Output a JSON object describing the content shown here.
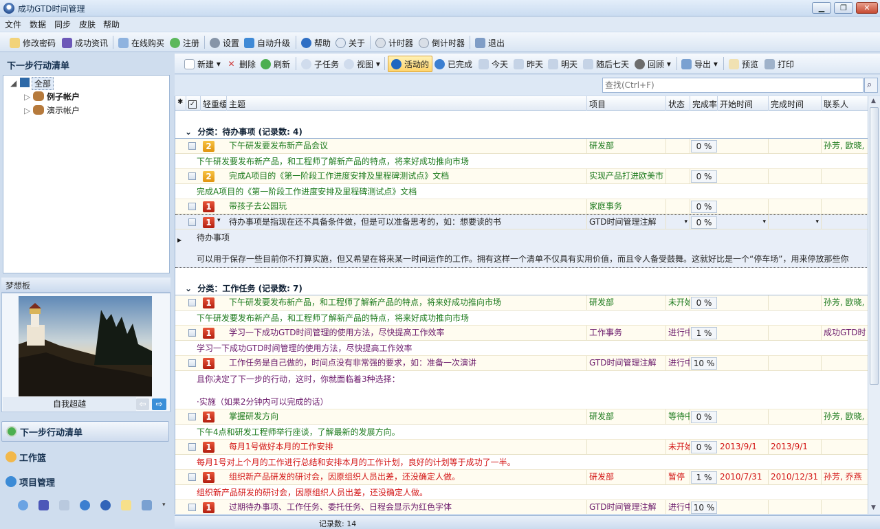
{
  "window": {
    "title": "成功GTD时间管理"
  },
  "menu": [
    "文件",
    "数据",
    "同步",
    "皮肤",
    "帮助"
  ],
  "toolbar1": [
    {
      "label": "修改密码",
      "icon": "key-icon"
    },
    {
      "label": "成功资讯",
      "icon": "book-icon"
    },
    {
      "label": "在线购买",
      "icon": "cart-icon"
    },
    {
      "label": "注册",
      "icon": "recycle-icon"
    },
    {
      "label": "设置",
      "icon": "gear-icon"
    },
    {
      "label": "自动升级",
      "icon": "up-arrow-icon"
    },
    {
      "label": "帮助",
      "icon": "help-icon"
    },
    {
      "label": "关于",
      "icon": "info-icon"
    },
    {
      "label": "计时器",
      "icon": "clock-icon"
    },
    {
      "label": "倒计时器",
      "icon": "countdown-icon"
    },
    {
      "label": "退出",
      "icon": "exit-icon"
    }
  ],
  "left": {
    "title": "下一步行动清单",
    "tree": {
      "root": "全部",
      "children": [
        "例子帐户",
        "演示帐户"
      ]
    },
    "dream": {
      "title": "梦想板",
      "caption": "自我超越"
    },
    "nav": [
      "下一步行动清单",
      "工作篮",
      "项目管理"
    ]
  },
  "toolbar2": [
    {
      "label": "新建",
      "icon": "new-doc-icon"
    },
    {
      "label": "删除",
      "icon": "delete-x-icon"
    },
    {
      "label": "刷新",
      "icon": "refresh-icon"
    },
    {
      "label": "子任务",
      "icon": "subtask-icon"
    },
    {
      "label": "视图",
      "icon": "view-icon"
    },
    {
      "label": "活动的",
      "icon": "info-icon"
    },
    {
      "label": "已完成",
      "icon": "check-icon"
    },
    {
      "label": "今天",
      "icon": "calendar-icon"
    },
    {
      "label": "昨天",
      "icon": "calendar-icon"
    },
    {
      "label": "明天",
      "icon": "calendar-icon"
    },
    {
      "label": "随后七天",
      "icon": "calendar-icon"
    },
    {
      "label": "回顾",
      "icon": "review-icon"
    },
    {
      "label": "导出",
      "icon": "export-icon"
    },
    {
      "label": "预览",
      "icon": "preview-icon"
    },
    {
      "label": "打印",
      "icon": "printer-icon"
    }
  ],
  "search": {
    "placeholder": "查找(Ctrl+F)"
  },
  "columns": [
    "轻重缓急",
    "主题",
    "项目",
    "状态",
    "完成率",
    "开始时间",
    "完成时间",
    "联系人"
  ],
  "groups": [
    {
      "title": "分类：待办事项 (记录数: 4)"
    },
    {
      "title": "分类：工作任务 (记录数: 7)"
    }
  ],
  "rows": [
    {
      "p": "2",
      "subject": "下午研发要发布新产品会议",
      "project": "研发部",
      "status": "",
      "pct": "0 %",
      "start": "",
      "end": "",
      "contact": "孙芳, 欧晓,",
      "note": "下午研发要发布新产品，和工程师了解新产品的特点，将来好成功推向市场"
    },
    {
      "p": "2",
      "subject": "完成A项目的《第一阶段工作进度安排及里程碑测试点》文档",
      "project": "实现产品打进欧美市",
      "status": "",
      "pct": "0 %",
      "start": "",
      "end": "",
      "contact": "",
      "note": "完成A项目的《第一阶段工作进度安排及里程碑测试点》文档"
    },
    {
      "p": "1",
      "subject": "带孩子去公园玩",
      "project": "家庭事务",
      "status": "",
      "pct": "0 %",
      "start": "",
      "end": "",
      "contact": "",
      "note": ""
    },
    {
      "p": "1",
      "subject": "待办事项是指现在还不具备条件做，但是可以准备思考的，如：想要读的书",
      "project": "GTD时间管理注解",
      "status": "",
      "pct": "0 %",
      "start": "",
      "end": "",
      "contact": "",
      "note": "待办事项",
      "note2": "可以用于保存一些目前你不打算实施，但又希望在将来某一时间运作的工作。拥有这样一个清单不仅具有实用价值，而且令人备受鼓舞。这就好比是一个“停车场”，用来停放那些你"
    },
    {
      "p": "1",
      "subject": "下午研发要发布新产品，和工程师了解新产品的特点，将来好成功推向市场",
      "project": "研发部",
      "status": "未开始",
      "pct": "0 %",
      "start": "",
      "end": "",
      "contact": "孙芳, 欧晓,",
      "note": "下午研发要发布新产品，和工程师了解新产品的特点，将来好成功推向市场"
    },
    {
      "p": "1",
      "subject": "学习一下成功GTD时间管理的使用方法，尽快提高工作效率",
      "project": "工作事务",
      "status": "进行中",
      "pct": "1 %",
      "start": "",
      "end": "",
      "contact": "成功GTD时",
      "note": "学习一下成功GTD时间管理的使用方法，尽快提高工作效率"
    },
    {
      "p": "1",
      "subject": "工作任务是自己做的，时间点没有非常强的要求，如：准备一次演讲",
      "project": "GTD时间管理注解",
      "status": "进行中",
      "pct": "10 %",
      "start": "",
      "end": "",
      "contact": "",
      "note": "且你决定了下一步的行动，这时，你就面临着3种选择：",
      "note2": "·实施（如果2分钟内可以完成的话）"
    },
    {
      "p": "1",
      "subject": "掌握研发方向",
      "project": "研发部",
      "status": "等待中",
      "pct": "0 %",
      "start": "",
      "end": "",
      "contact": "孙芳, 欧晓,",
      "note": "下午4点和研发工程师举行座谈，了解最新的发展方向。"
    },
    {
      "p": "1",
      "subject": "每月1号做好本月的工作安排",
      "project": "",
      "status": "未开始",
      "pct": "0 %",
      "start": "2013/9/1",
      "end": "2013/9/1",
      "contact": "",
      "note": "每月1号对上个月的工作进行总结和安排本月的工作计划，良好的计划等于成功了一半。"
    },
    {
      "p": "1",
      "subject": "组织新产品研发的研讨会，因原组织人员出差，还没确定人做。",
      "project": "研发部",
      "status": "暂停",
      "pct": "1 %",
      "start": "2010/7/31",
      "end": "2010/12/31",
      "contact": "孙芳, 乔燕",
      "note": "组织新产品研发的研讨会，因原组织人员出差，还没确定人做。"
    },
    {
      "p": "1",
      "subject": "过期待办事项、工作任务、委托任务、日程会显示为红色字体",
      "project": "GTD时间管理注解",
      "status": "进行中",
      "pct": "10 %",
      "start": "",
      "end": "",
      "contact": "",
      "note": ""
    }
  ],
  "status": {
    "count": "记录数: 14"
  },
  "colors": {
    "accent": "#f6c243",
    "urgent": "#c9301b",
    "overdue": "#d31515"
  }
}
